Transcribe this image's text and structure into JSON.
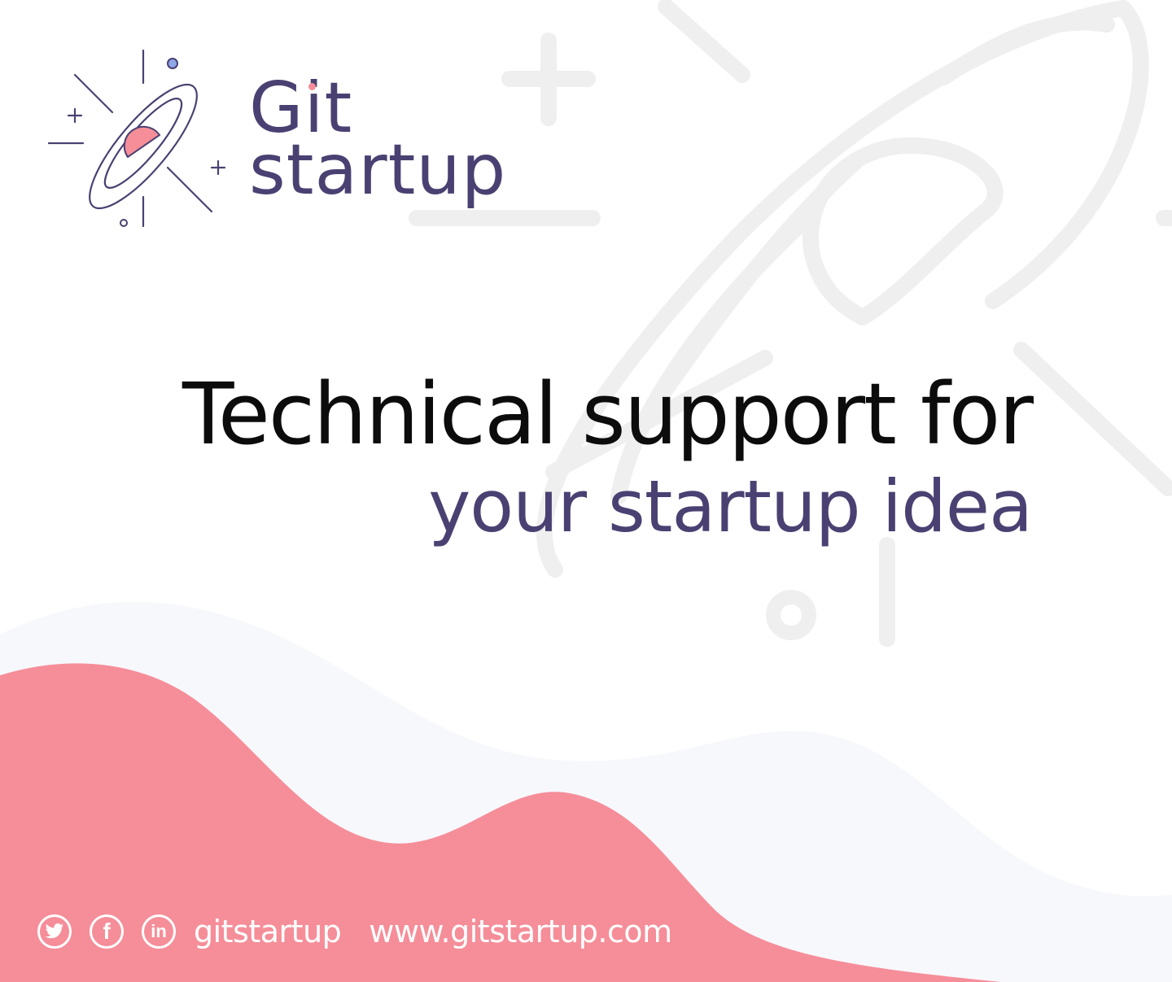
{
  "brand": {
    "line1": "Git",
    "line2": "startup"
  },
  "headline": {
    "line1": "Technical support for",
    "line2": "your startup idea"
  },
  "footer": {
    "social_handle": "gitstartup",
    "website": "www.gitstartup.com",
    "icons": [
      "twitter-icon",
      "facebook-icon",
      "linkedin-icon"
    ],
    "facebook_glyph": "f",
    "linkedin_glyph": "in"
  },
  "colors": {
    "brand_purple": "#4a4172",
    "accent_pink": "#f58e99",
    "text_dark": "#0c0c0c",
    "background": "#ffffff",
    "decor_gray": "#efefef"
  }
}
